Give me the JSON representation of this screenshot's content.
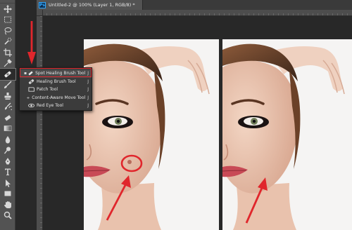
{
  "document_tab": {
    "title": "Untitled-2 @ 100% (Layer 1, RGB/8) *",
    "app_badge": "Ps"
  },
  "toolbar": {
    "tools": [
      "move-icon",
      "marquee-icon",
      "lasso-icon",
      "quick-select-icon",
      "crop-icon",
      "eyedropper-icon",
      "spot-healing-brush-icon",
      "brush-icon",
      "clone-stamp-icon",
      "history-brush-icon",
      "eraser-icon",
      "gradient-icon",
      "blur-icon",
      "dodge-icon",
      "pen-icon",
      "type-icon",
      "path-select-icon",
      "shape-icon",
      "hand-icon",
      "zoom-icon"
    ]
  },
  "flyout": {
    "items": [
      {
        "label": "Spot Healing Brush Tool",
        "key": "J",
        "icon": "spot-healing-brush-icon",
        "selected": true
      },
      {
        "label": "Healing Brush Tool",
        "key": "J",
        "icon": "healing-brush-icon",
        "selected": false
      },
      {
        "label": "Patch Tool",
        "key": "J",
        "icon": "patch-icon",
        "selected": false
      },
      {
        "label": "Content-Aware Move Tool",
        "key": "J",
        "icon": "content-aware-move-icon",
        "selected": false
      },
      {
        "label": "Red Eye Tool",
        "key": "J",
        "icon": "red-eye-icon",
        "selected": false
      }
    ]
  },
  "colors": {
    "annotation_red": "#e0262c",
    "panel": "#535353",
    "canvas": "#282828"
  }
}
